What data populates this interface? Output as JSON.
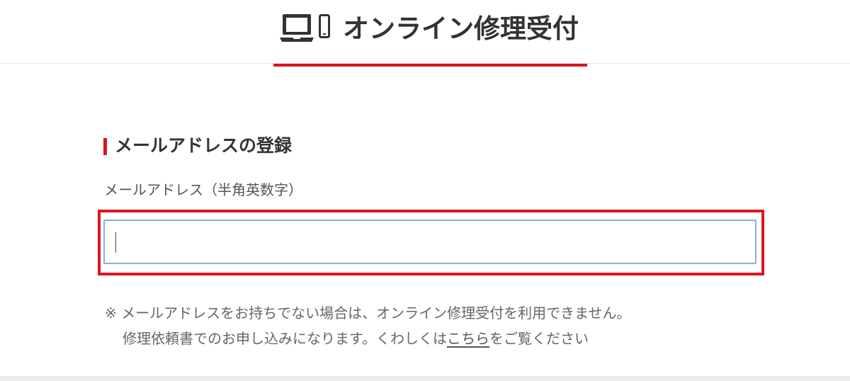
{
  "header": {
    "title": "オンライン修理受付",
    "icons": [
      "laptop-icon",
      "smartphone-icon"
    ],
    "accent_color": "#d7141e"
  },
  "section": {
    "heading": "メールアドレスの登録"
  },
  "email_form": {
    "label": "メールアドレス（半角英数字）",
    "value": "",
    "placeholder": "",
    "input_border_color": "#80b3dc",
    "highlight_color": "#e0141e"
  },
  "notes": {
    "line1": "※ メールアドレスをお持ちでない場合は、オンライン修理受付を利用できません。",
    "line2_prefix": "修理依頼書でのお申し込みになります。くわしくは",
    "link_text": "こちら",
    "line2_suffix": "をご覧ください"
  }
}
